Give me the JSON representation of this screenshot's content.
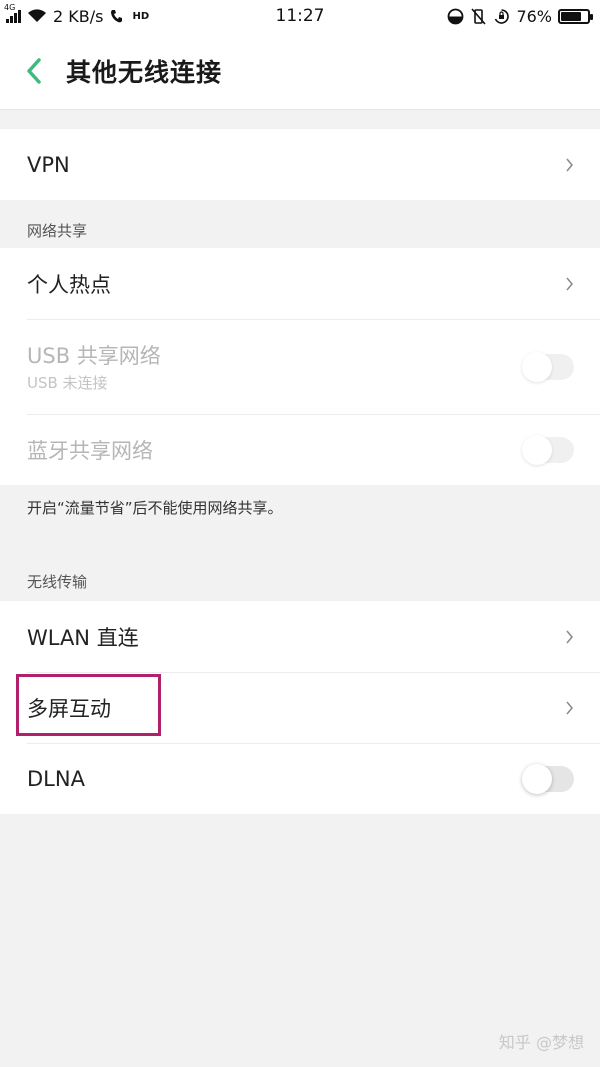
{
  "status_bar": {
    "network_tag": "4G",
    "speed": "2 KB/s",
    "hd_tag": "HD",
    "time": "11:27",
    "battery_percent": "76%",
    "battery_level": 0.76
  },
  "header": {
    "title": "其他无线连接"
  },
  "vpn": {
    "label": "VPN"
  },
  "sharing": {
    "header": "网络共享",
    "hotspot_label": "个人热点",
    "usb_label": "USB 共享网络",
    "usb_sub": "USB 未连接",
    "bluetooth_label": "蓝牙共享网络",
    "note": "开启“流量节省”后不能使用网络共享。"
  },
  "wireless": {
    "header": "无线传输",
    "wlan_direct_label": "WLAN 直连",
    "multiscreen_label": "多屏互动",
    "dlna_label": "DLNA"
  },
  "colors": {
    "accent_green": "#3dba7e",
    "highlight_box": "#b0206b"
  },
  "watermark": "知乎 @梦想"
}
